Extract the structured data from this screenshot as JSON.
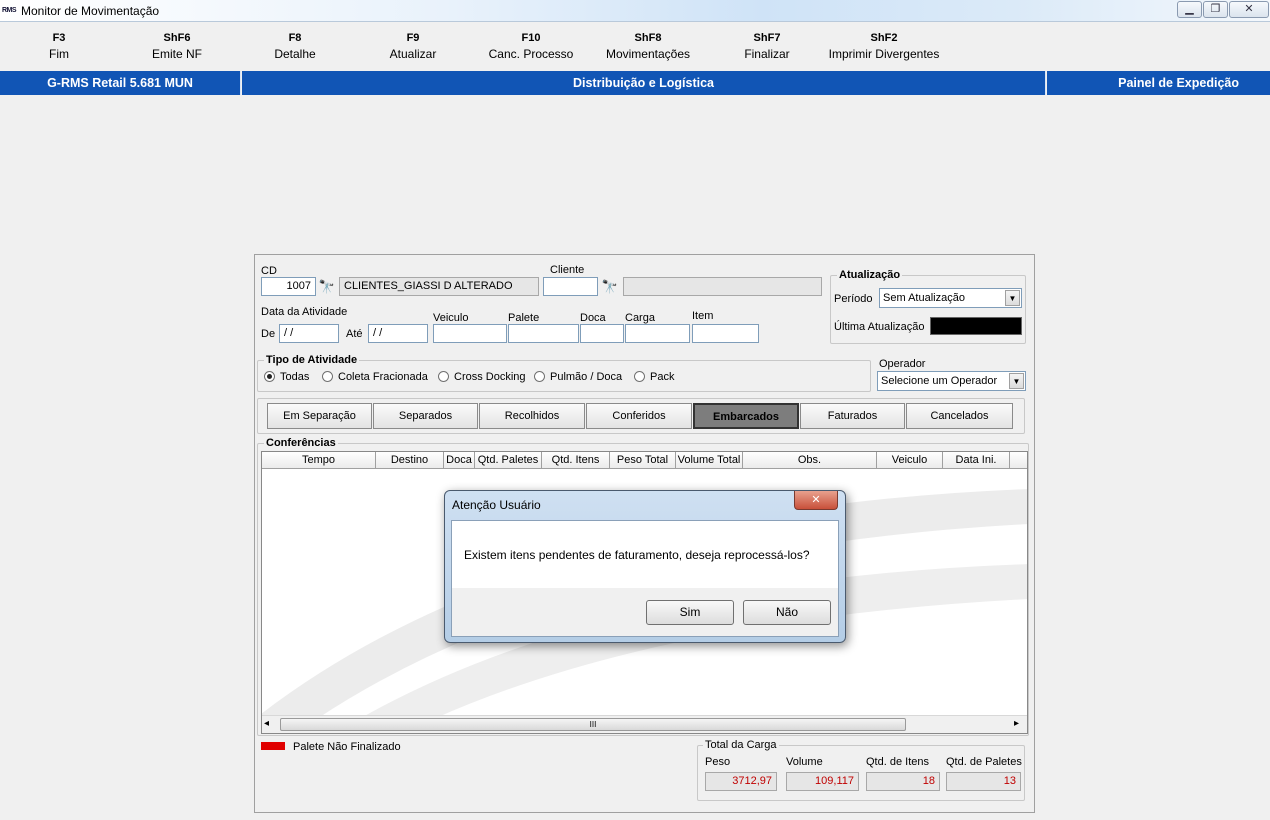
{
  "window": {
    "icon_text": "RMS",
    "title": "Monitor de Movimentação",
    "minimize": "▁",
    "restore": "❐",
    "close": "✕"
  },
  "toolbar": [
    {
      "key": "F3",
      "label": "Fim"
    },
    {
      "key": "ShF6",
      "label": "Emite NF"
    },
    {
      "key": "F8",
      "label": "Detalhe"
    },
    {
      "key": "F9",
      "label": "Atualizar"
    },
    {
      "key": "F10",
      "label": "Canc. Processo"
    },
    {
      "key": "ShF8",
      "label": "Movimentações"
    },
    {
      "key": "ShF7",
      "label": "Finalizar"
    },
    {
      "key": "ShF2",
      "label": "Imprimir Divergentes"
    }
  ],
  "header": {
    "left": "G-RMS Retail 5.681 MUN",
    "center": "Distribuição e Logística",
    "right": "Painel de Expedição"
  },
  "form": {
    "cd_label": "CD",
    "cd_value": "1007",
    "cd_name": "CLIENTES_GIASSI D ALTERADO",
    "cliente_label": "Cliente",
    "cliente_value": "",
    "cliente_name": "",
    "data_label": "Data da Atividade",
    "de_label": "De",
    "de_value": " / /",
    "ate_label": "Até",
    "ate_value": " / /",
    "veiculo_label": "Veiculo",
    "palete_label": "Palete",
    "doca_label": "Doca",
    "carga_label": "Carga",
    "item_label": "Item",
    "binoculars": "🔭"
  },
  "atualizacao": {
    "title": "Atualização",
    "periodo_label": "Período",
    "periodo_value": "Sem Atualização",
    "ultima_label": "Última Atualização",
    "ultima_color": "#000000"
  },
  "tipo": {
    "title": "Tipo de Atividade",
    "options": [
      "Todas",
      "Coleta Fracionada",
      "Cross Docking",
      "Pulmão / Doca",
      "Pack"
    ],
    "selected": "Todas"
  },
  "operador": {
    "label": "Operador",
    "value": "Selecione um Operador"
  },
  "tabs": [
    {
      "label": "Em Separação",
      "active": false
    },
    {
      "label": "Separados",
      "active": false
    },
    {
      "label": "Recolhidos",
      "active": false
    },
    {
      "label": "Conferidos",
      "active": false
    },
    {
      "label": "Embarcados",
      "active": true
    },
    {
      "label": "Faturados",
      "active": false
    },
    {
      "label": "Cancelados",
      "active": false
    }
  ],
  "grid": {
    "title": "Conferências",
    "columns": [
      "Tempo",
      "Destino",
      "Doca",
      "Qtd. Paletes",
      "Qtd. Itens",
      "Peso Total",
      "Volume Total",
      "Obs.",
      "Veiculo",
      "Data Ini."
    ],
    "scroll_grip": "III",
    "scroll_left": "◂",
    "scroll_right": "▸"
  },
  "legend": {
    "color": "#e00000",
    "label": "Palete Não Finalizado"
  },
  "totals": {
    "title": "Total da Carga",
    "peso_label": "Peso",
    "peso": "3712,97",
    "volume_label": "Volume",
    "volume": "109,117",
    "itens_label": "Qtd. de Itens",
    "itens": "18",
    "paletes_label": "Qtd. de Paletes",
    "paletes": "13"
  },
  "dialog": {
    "title": "Atenção Usuário",
    "close": "✕",
    "message": "Existem itens pendentes de faturamento, deseja reprocessá-los?",
    "yes": "Sim",
    "no": "Não"
  },
  "colors": {
    "header_blue": "#1155b5",
    "totals_red": "#c00000"
  }
}
